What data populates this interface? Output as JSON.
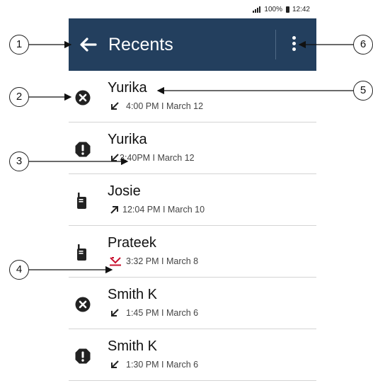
{
  "status_bar": {
    "battery": "100%",
    "time": "12:42"
  },
  "header": {
    "title": "Recents",
    "back_icon": "back-arrow-icon",
    "menu_icon": "more-vert-icon",
    "background": "#233f5e"
  },
  "recents": [
    {
      "name": "Yurika",
      "time": "4:00 PM I March 12",
      "type_icon": "missed-call-icon",
      "direction_icon": "incoming-arrow-icon"
    },
    {
      "name": "Yurika",
      "time": "3:40PM I March 12",
      "type_icon": "alert-icon",
      "direction_icon": "incoming-arrow-icon"
    },
    {
      "name": "Josie",
      "time": "12:04 PM I March 10",
      "type_icon": "radio-icon",
      "direction_icon": "outgoing-arrow-icon"
    },
    {
      "name": "Prateek",
      "time": "3:32 PM I March 8",
      "type_icon": "radio-icon",
      "direction_icon": "missed-arrow-icon"
    },
    {
      "name": "Smith K",
      "time": "1:45 PM I March 6",
      "type_icon": "missed-call-icon",
      "direction_icon": "incoming-arrow-icon"
    },
    {
      "name": "Smith K",
      "time": "1:30 PM I March 6",
      "type_icon": "alert-icon",
      "direction_icon": "incoming-arrow-icon"
    }
  ],
  "callouts": [
    "1",
    "2",
    "3",
    "4",
    "5",
    "6"
  ],
  "colors": {
    "missed": "#c8102e",
    "icon": "#222222"
  }
}
